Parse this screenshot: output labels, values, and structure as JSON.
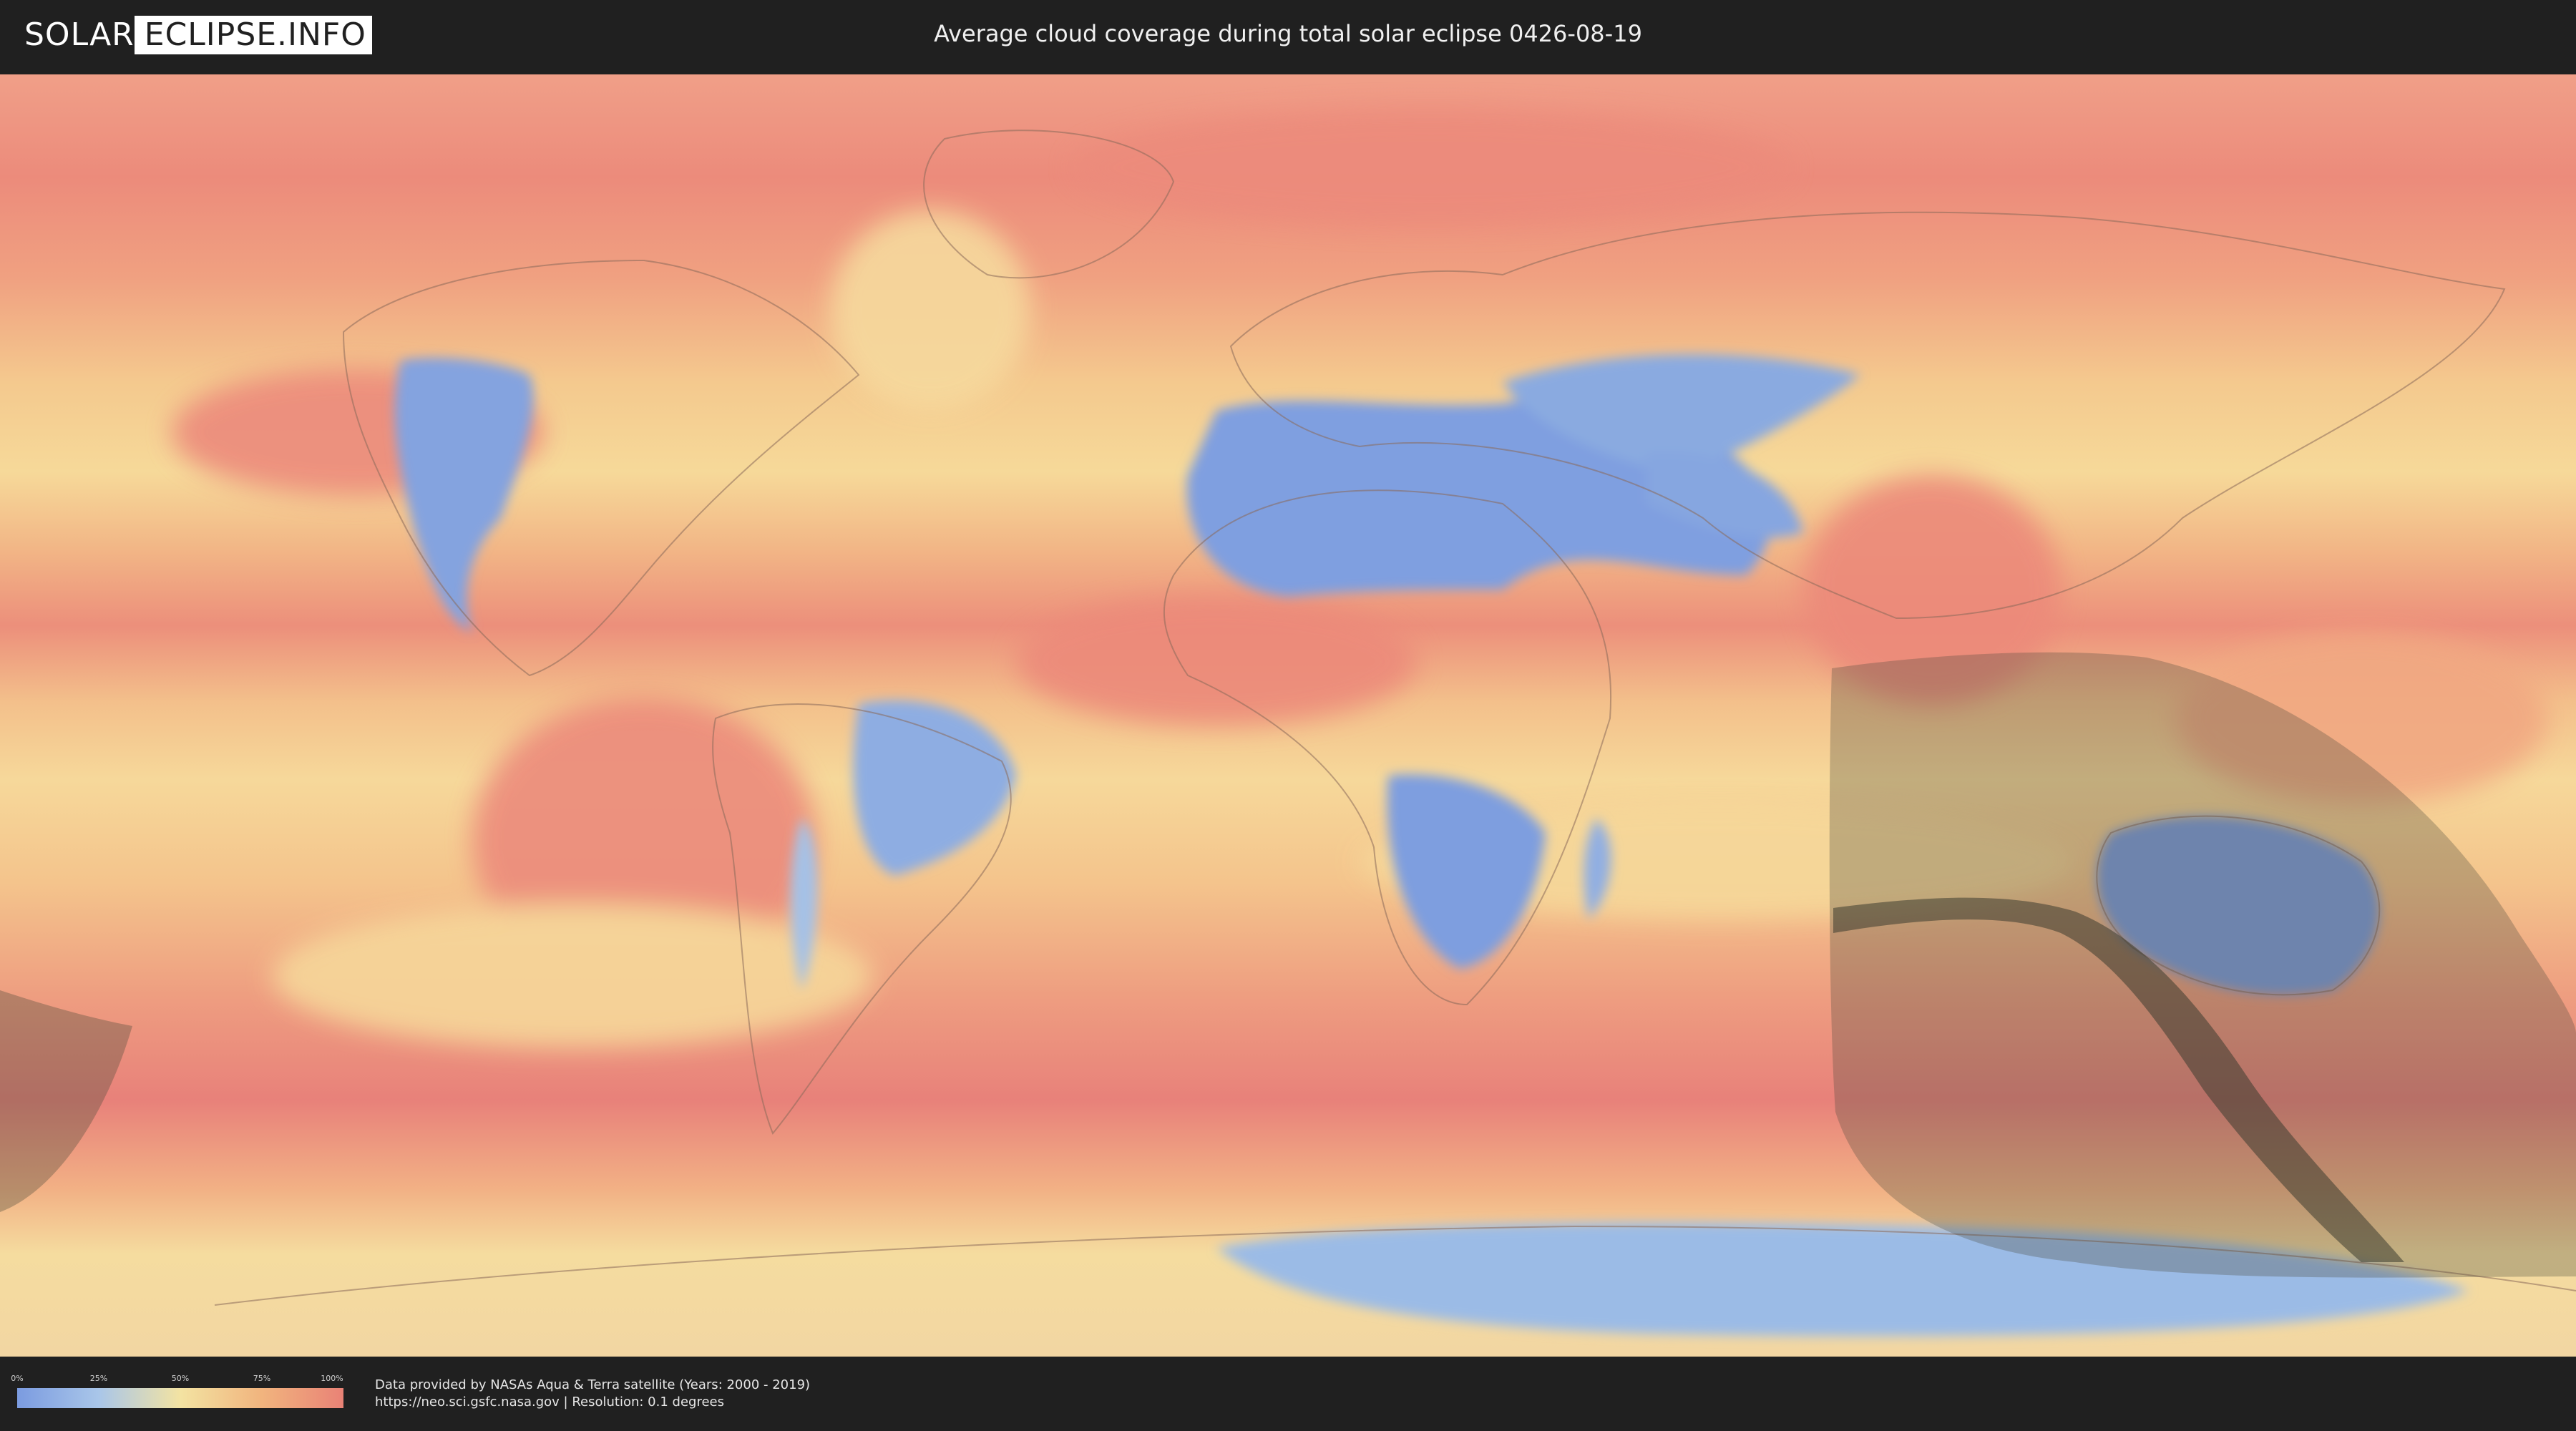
{
  "header": {
    "logo_left": "SOLAR",
    "logo_right": "ECLIPSE.INFO",
    "title": "Average cloud coverage during total solar eclipse 0426-08-19"
  },
  "legend": {
    "ticks": [
      "0%",
      "25%",
      "50%",
      "75%",
      "100%"
    ],
    "colors": [
      "#7b9be0",
      "#a9c6e9",
      "#f3e3a2",
      "#f1b47e",
      "#e98276"
    ]
  },
  "footer": {
    "credit_line1": "Data provided by NASAs Aqua & Terra satellite (Years: 2000 - 2019)",
    "credit_line2": "https://neo.sci.gsfc.nasa.gov | Resolution: 0.1 degrees"
  },
  "map": {
    "projection": "equirectangular",
    "colors": {
      "clear": "#7b9be0",
      "low": "#a9c6e9",
      "mid": "#f3e3a2",
      "high": "#f1b47e",
      "overcast": "#e98276",
      "eclipse_shadow": "#4a4a3a"
    }
  }
}
